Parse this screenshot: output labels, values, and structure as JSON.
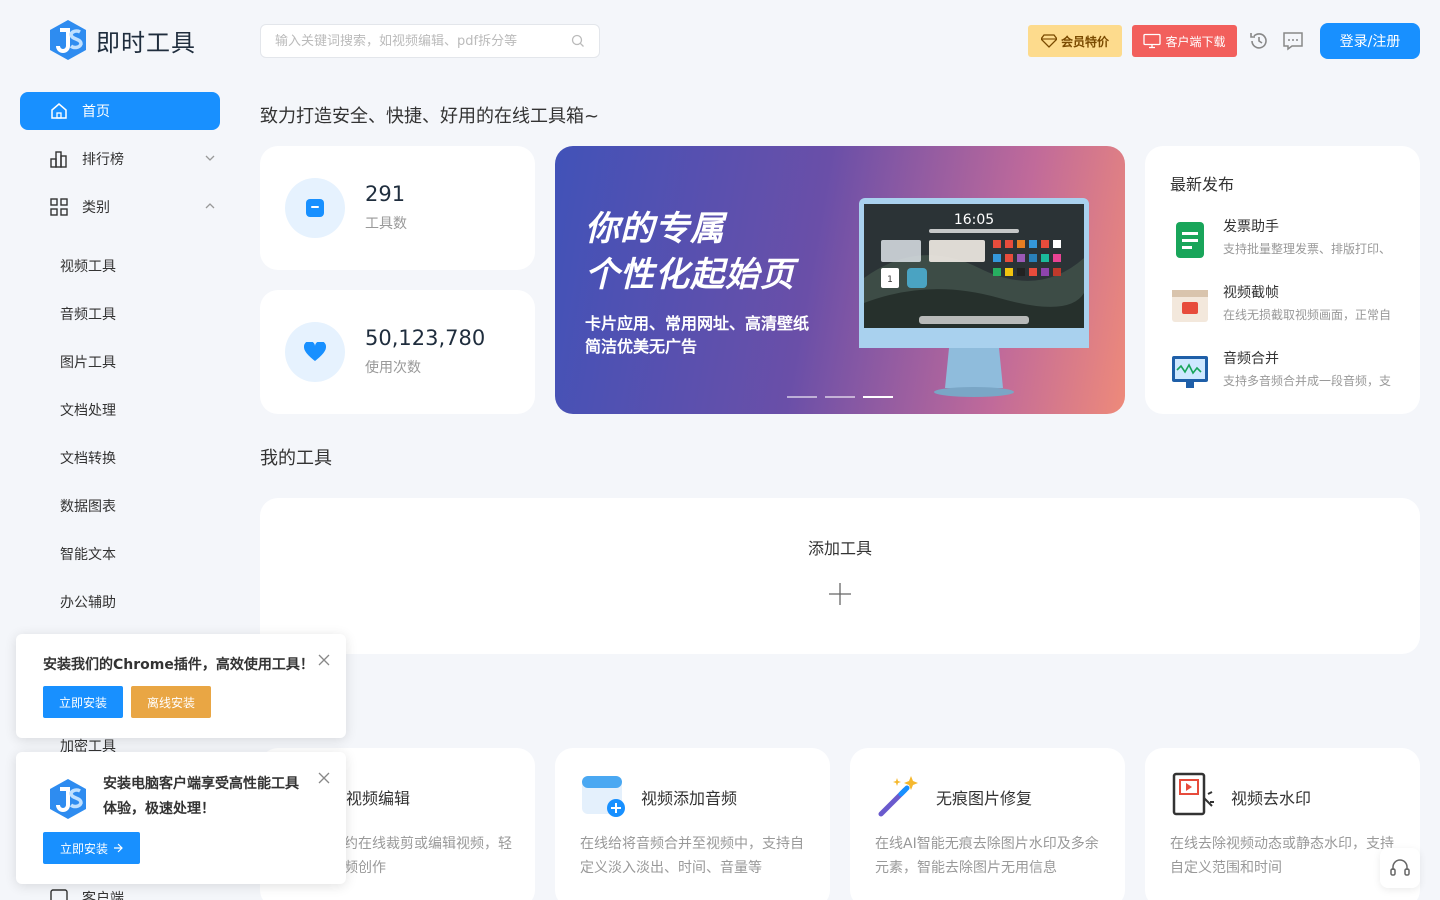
{
  "brand": {
    "name": "即时工具"
  },
  "search": {
    "placeholder": "输入关键词搜索，如视频编辑、pdf拆分等"
  },
  "header": {
    "vip_label": "会员特价",
    "client_label": "客户端下载",
    "login_label": "登录/注册",
    "colors": {
      "accent": "#1890ff",
      "vip": "#fddb8d",
      "client": "#f25f5c"
    }
  },
  "sidebar": {
    "items": [
      {
        "label": "首页",
        "icon": "home-icon"
      },
      {
        "label": "排行榜",
        "icon": "chart-icon"
      },
      {
        "label": "类别",
        "icon": "grid-icon"
      }
    ],
    "categories": [
      "视频工具",
      "音频工具",
      "图片工具",
      "文档处理",
      "文档转换",
      "数据图表",
      "智能文本",
      "办公辅助"
    ],
    "hidden_item": "加密工具",
    "bottom_label": "客户端"
  },
  "main": {
    "tagline": "致力打造安全、快捷、好用的在线工具箱~",
    "stats": [
      {
        "value": "291",
        "label": "工具数"
      },
      {
        "value": "50,123,780",
        "label": "使用次数"
      }
    ],
    "banner": {
      "headline_1": "你的专属",
      "headline_2": "个性化起始页",
      "sub_1": "卡片应用、常用网址、高清壁纸",
      "sub_2": "简洁优美无广告",
      "time": "16:05",
      "date_num": "1"
    },
    "latest": {
      "title": "最新发布",
      "items": [
        {
          "name": "发票助手",
          "desc": "支持批量整理发票、排版打印、"
        },
        {
          "name": "视频截帧",
          "desc": "在线无损截取视频画面，正常自"
        },
        {
          "name": "音频合并",
          "desc": "支持多音频合并成一段音频，支"
        }
      ]
    },
    "my_tools": {
      "title": "我的工具",
      "add_label": "添加工具"
    },
    "tools": [
      {
        "name": "视频编辑",
        "desc": "约在线裁剪或编辑视频，轻\n频创作"
      },
      {
        "name": "视频添加音频",
        "desc": "在线给将音频合并至视频中，支持自定义淡入淡出、时间、音量等"
      },
      {
        "name": "无痕图片修复",
        "desc": "在线AI智能无痕去除图片水印及多余元素，智能去除图片无用信息"
      },
      {
        "name": "视频去水印",
        "desc": "在线去除视频动态或静态水印，支持自定义范围和时间"
      }
    ]
  },
  "popups": {
    "chrome": {
      "text": "安装我们的Chrome插件，高效使用工具！",
      "install": "立即安装",
      "offline": "离线安装"
    },
    "desktop": {
      "text_1": "安装电脑客户端享受高性能工具",
      "text_2": "体验，极速处理！",
      "install": "立即安装"
    }
  }
}
